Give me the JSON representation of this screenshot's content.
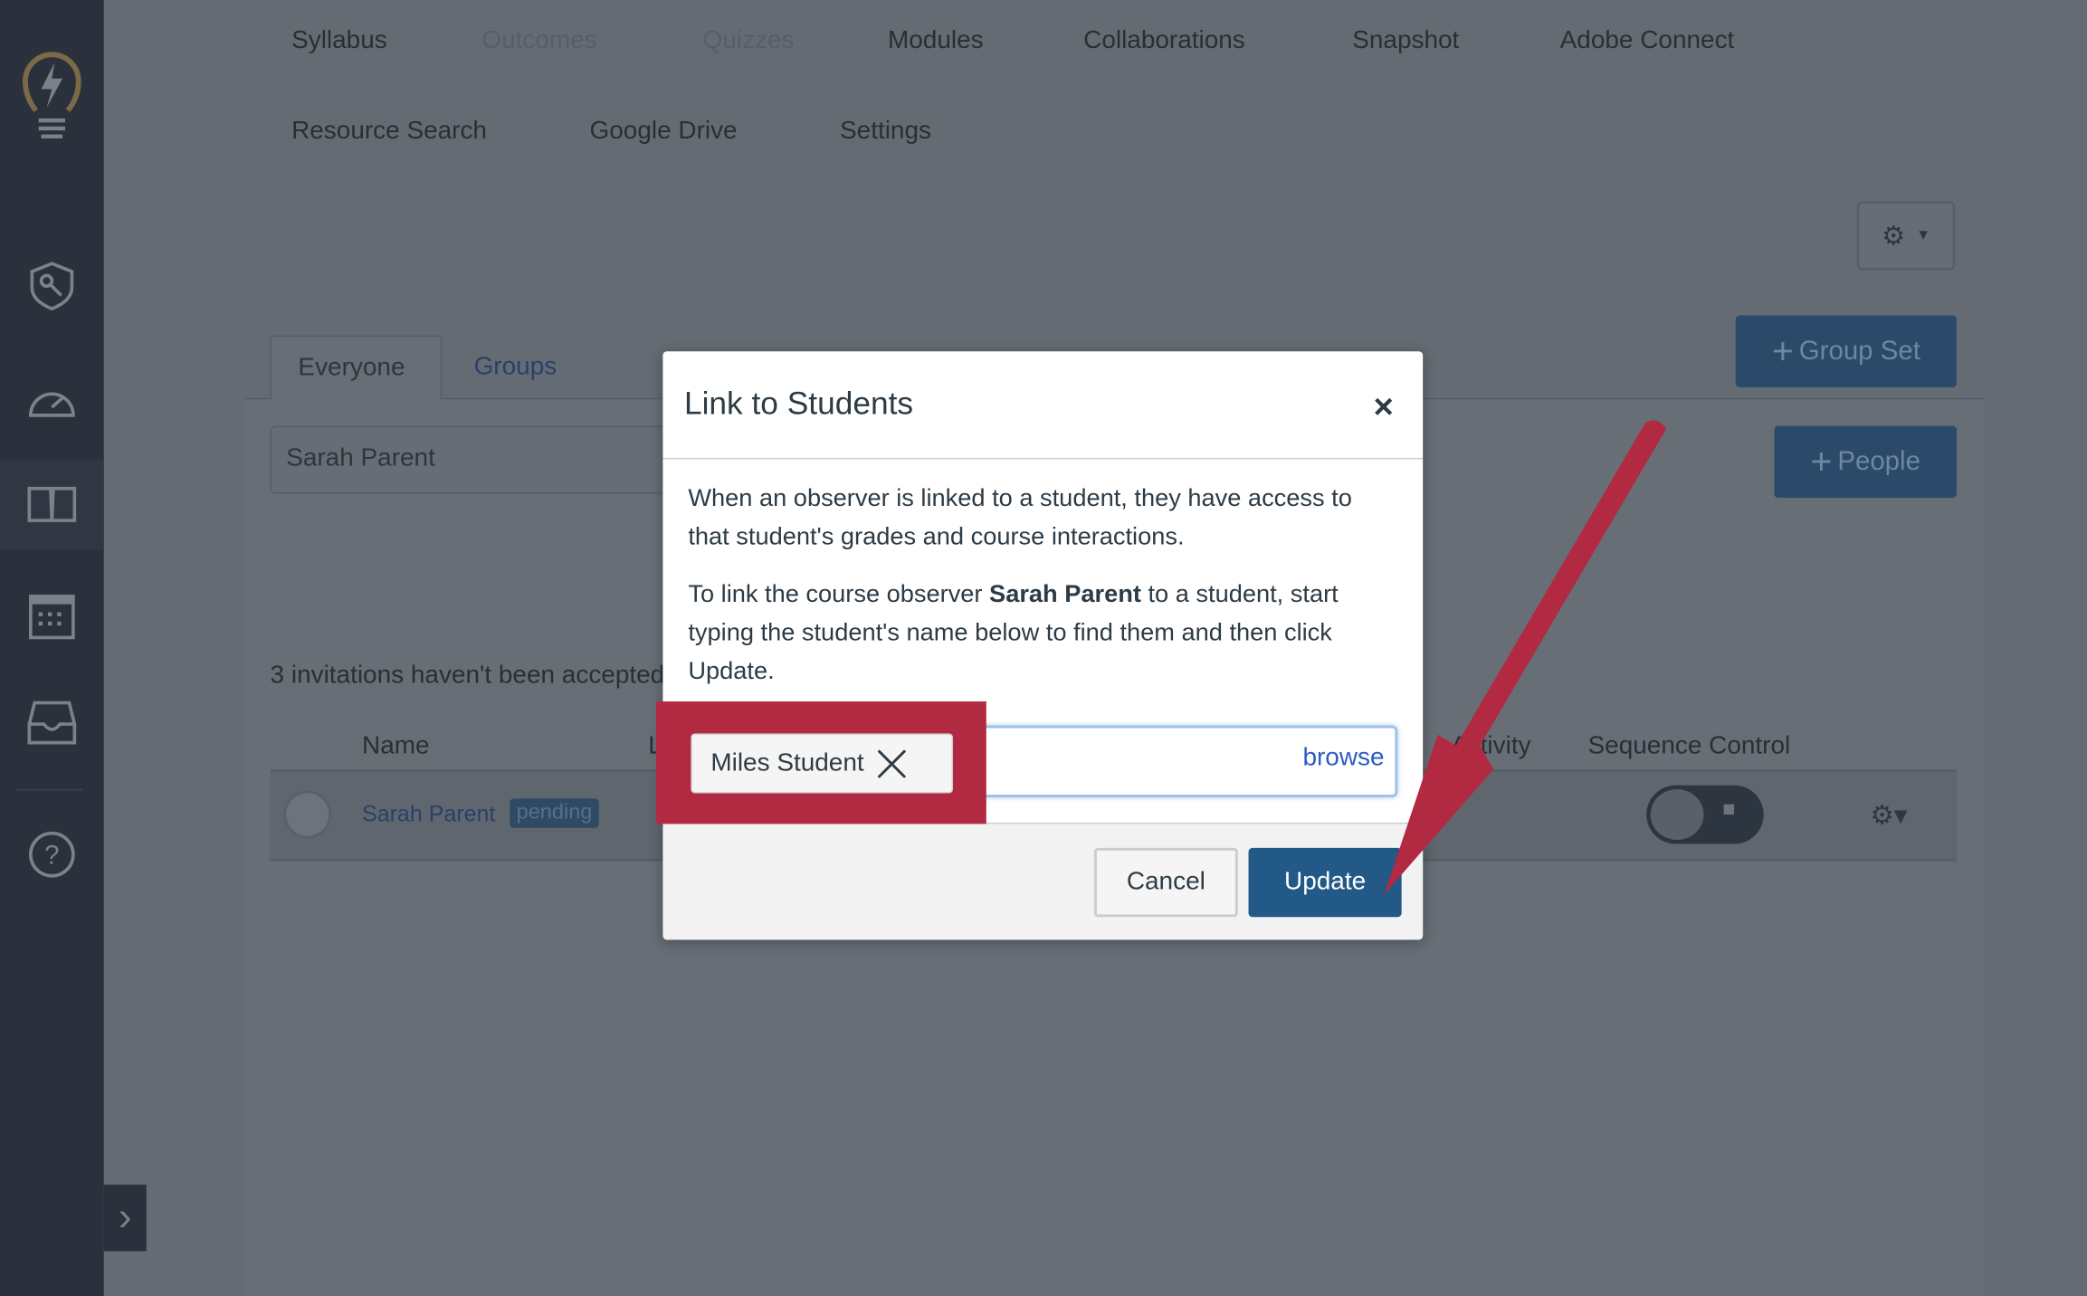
{
  "nav": {
    "items": [
      {
        "label": "Syllabus",
        "disabled": false
      },
      {
        "label": "Outcomes",
        "disabled": true
      },
      {
        "label": "Quizzes",
        "disabled": true
      },
      {
        "label": "Modules",
        "disabled": false
      },
      {
        "label": "Collaborations",
        "disabled": false
      },
      {
        "label": "Snapshot",
        "disabled": false
      },
      {
        "label": "Adobe Connect",
        "disabled": false
      },
      {
        "label": "Resource Search",
        "disabled": false
      },
      {
        "label": "Google Drive",
        "disabled": false
      },
      {
        "label": "Settings",
        "disabled": false
      }
    ]
  },
  "sidebar": {
    "icons": [
      "logo-lightbulb-icon",
      "admin-shield-key-icon",
      "dashboard-gauge-icon",
      "courses-book-icon",
      "calendar-icon",
      "inbox-icon",
      "help-icon"
    ],
    "expand_icon": "chevron-right-icon"
  },
  "toolbar": {
    "group_set_label": "Group Set",
    "people_label": "People"
  },
  "tabs": [
    {
      "label": "Everyone",
      "active": true
    },
    {
      "label": "Groups",
      "active": false
    }
  ],
  "search": {
    "value": "Sarah Parent"
  },
  "invitations_text": "3 invitations haven't been accepted",
  "table": {
    "headers": [
      "Name",
      "L",
      "Activity",
      "Sequence Control"
    ],
    "rows": [
      {
        "name": "Sarah Parent",
        "badge": "pending"
      }
    ]
  },
  "modal": {
    "title": "Link to Students",
    "close": "×",
    "para1": "When an observer is linked to a student, they have access to that student's grades and course interactions.",
    "para2_pre": "To link the course observer ",
    "para2_bold": "Sarah Parent",
    "para2_post": " to a student, start typing the student's name below to find them and then click Update.",
    "token": "Miles Student",
    "browse": "browse",
    "cancel": "Cancel",
    "update": "Update"
  },
  "colors": {
    "annotation": "#b22a42",
    "primary": "#225987",
    "link": "#2b5cc4"
  }
}
